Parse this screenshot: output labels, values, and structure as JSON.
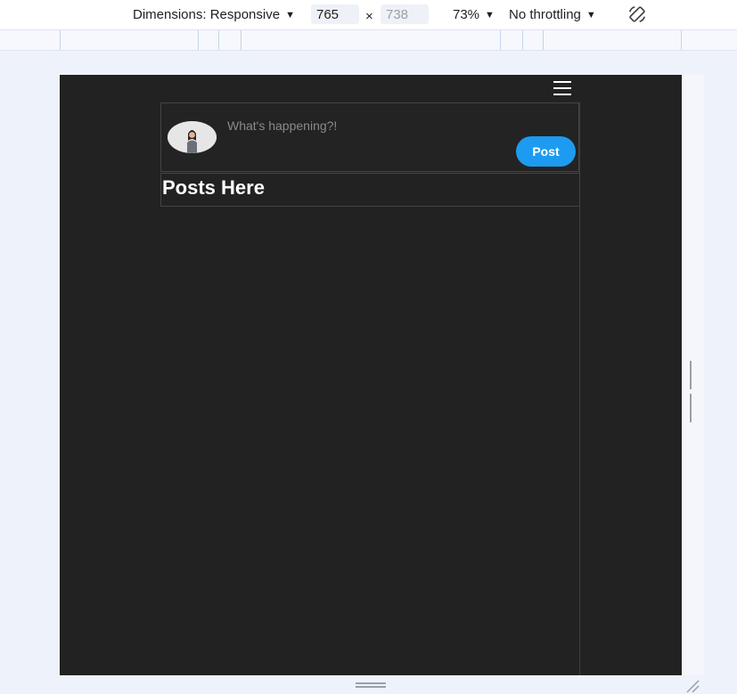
{
  "toolbar": {
    "dimensions_label": "Dimensions: Responsive",
    "width_value": "765",
    "height_placeholder": "738",
    "times": "×",
    "zoom_label": "73%",
    "throttling_label": "No throttling",
    "caret": "▼"
  },
  "app": {
    "composer_placeholder": "What's happening?!",
    "post_button": "Post",
    "posts_heading": "Posts Here"
  },
  "colors": {
    "viewport_bg": "#222222",
    "post_button": "#1d9bf0",
    "devtools_bg": "#eef2fa"
  }
}
